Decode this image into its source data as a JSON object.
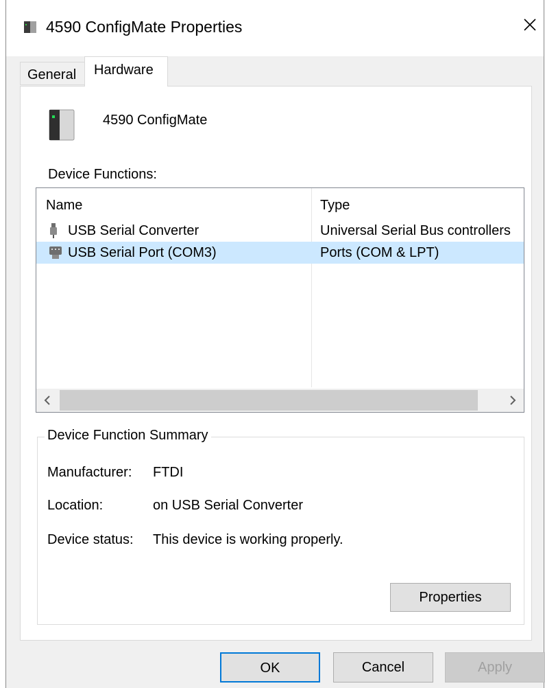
{
  "window": {
    "title": "4590 ConfigMate Properties"
  },
  "tabs": [
    {
      "label": "General",
      "active": false
    },
    {
      "label": "Hardware",
      "active": true
    }
  ],
  "device": {
    "name": "4590 ConfigMate"
  },
  "device_functions": {
    "label": "Device Functions:",
    "columns": [
      "Name",
      "Type"
    ],
    "rows": [
      {
        "name": "USB Serial Converter",
        "type": "Universal Serial Bus controllers",
        "icon": "usb-connector-icon",
        "selected": false
      },
      {
        "name": "USB Serial Port (COM3)",
        "type": "Ports (COM & LPT)",
        "icon": "serial-port-icon",
        "selected": true
      }
    ]
  },
  "summary": {
    "title": "Device Function Summary",
    "manufacturer_label": "Manufacturer:",
    "manufacturer": "FTDI",
    "location_label": "Location:",
    "location": "on USB Serial Converter",
    "status_label": "Device status:",
    "status": "This device is working properly.",
    "properties_button": "Properties"
  },
  "buttons": {
    "ok": "OK",
    "cancel": "Cancel",
    "apply": "Apply"
  },
  "colors": {
    "selection": "#cce8ff",
    "default_button_border": "#0078d7",
    "window_bg": "#f0f0f0"
  }
}
